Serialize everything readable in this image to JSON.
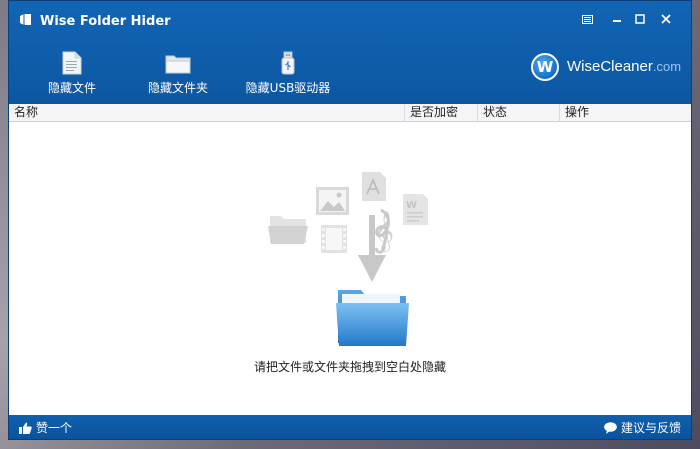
{
  "window": {
    "title": "Wise Folder Hider"
  },
  "toolbar": {
    "hide_file": "隐藏文件",
    "hide_folder": "隐藏文件夹",
    "hide_usb": "隐藏USB驱动器"
  },
  "brand": {
    "name": "WiseCleaner",
    "suffix": ".com",
    "logo_letter": "W"
  },
  "columns": [
    "名称",
    "是否加密",
    "状态",
    "操作"
  ],
  "content": {
    "drop_hint": "请把文件或文件夹拖拽到空白处隐藏"
  },
  "footer": {
    "like_label": "赞一个",
    "feedback_label": "建议与反馈"
  },
  "colors": {
    "header_blue": "#0f5fae",
    "footer_blue": "#0d59a5",
    "folder_blue": "#3d9ae6"
  },
  "icons": [
    "app-icon",
    "minimize-icon",
    "maximize-icon",
    "close-icon",
    "menu-icon",
    "file-icon",
    "folder-icon",
    "usb-icon",
    "thumbs-up-icon",
    "speech-bubble-icon"
  ]
}
